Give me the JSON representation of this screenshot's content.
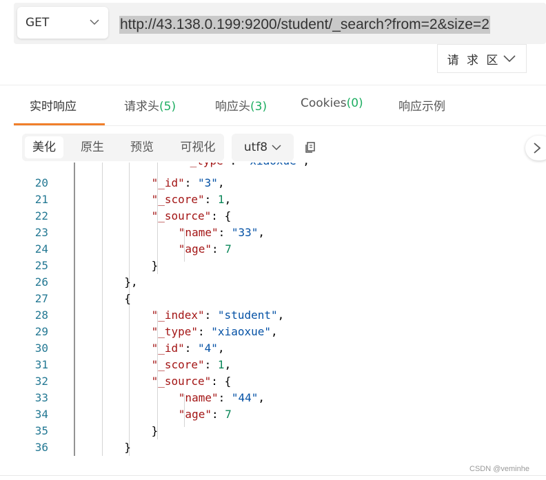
{
  "request": {
    "method": "GET",
    "url": "http://43.138.0.199:9200/student/_search?from=2&size=2",
    "region_label": "请 求 区"
  },
  "tabs": [
    {
      "label": "实时响应",
      "count": ""
    },
    {
      "label": "请求头",
      "count": "(5)"
    },
    {
      "label": "响应头",
      "count": "(3)"
    },
    {
      "label": "Cookies",
      "count": "(0)"
    },
    {
      "label": "响应示例",
      "count": ""
    }
  ],
  "toolbar": {
    "items": [
      "美化",
      "原生",
      "预览",
      "可视化"
    ],
    "encoding": "utf8"
  },
  "code_lines": [
    {
      "n": "20",
      "indent": 6,
      "tokens": [
        {
          "t": "\"_id\"",
          "c": "k"
        },
        {
          "t": ": ",
          "c": ""
        },
        {
          "t": "\"3\"",
          "c": "s"
        },
        {
          "t": ",",
          "c": ""
        }
      ]
    },
    {
      "n": "21",
      "indent": 6,
      "tokens": [
        {
          "t": "\"_score\"",
          "c": "k"
        },
        {
          "t": ": ",
          "c": ""
        },
        {
          "t": "1",
          "c": "n"
        },
        {
          "t": ",",
          "c": ""
        }
      ]
    },
    {
      "n": "22",
      "indent": 6,
      "tokens": [
        {
          "t": "\"_source\"",
          "c": "k"
        },
        {
          "t": ": {",
          "c": ""
        }
      ]
    },
    {
      "n": "23",
      "indent": 8,
      "tokens": [
        {
          "t": "\"name\"",
          "c": "k"
        },
        {
          "t": ": ",
          "c": ""
        },
        {
          "t": "\"33\"",
          "c": "s"
        },
        {
          "t": ",",
          "c": ""
        }
      ]
    },
    {
      "n": "24",
      "indent": 8,
      "tokens": [
        {
          "t": "\"age\"",
          "c": "k"
        },
        {
          "t": ": ",
          "c": ""
        },
        {
          "t": "7",
          "c": "n"
        }
      ]
    },
    {
      "n": "25",
      "indent": 6,
      "tokens": [
        {
          "t": "}",
          "c": ""
        }
      ]
    },
    {
      "n": "26",
      "indent": 4,
      "tokens": [
        {
          "t": "},",
          "c": ""
        }
      ]
    },
    {
      "n": "27",
      "indent": 4,
      "tokens": [
        {
          "t": "{",
          "c": ""
        }
      ]
    },
    {
      "n": "28",
      "indent": 6,
      "tokens": [
        {
          "t": "\"_index\"",
          "c": "k"
        },
        {
          "t": ": ",
          "c": ""
        },
        {
          "t": "\"student\"",
          "c": "s"
        },
        {
          "t": ",",
          "c": ""
        }
      ]
    },
    {
      "n": "29",
      "indent": 6,
      "tokens": [
        {
          "t": "\"_type\"",
          "c": "k"
        },
        {
          "t": ": ",
          "c": ""
        },
        {
          "t": "\"xiaoxue\"",
          "c": "s"
        },
        {
          "t": ",",
          "c": ""
        }
      ]
    },
    {
      "n": "30",
      "indent": 6,
      "tokens": [
        {
          "t": "\"_id\"",
          "c": "k"
        },
        {
          "t": ": ",
          "c": ""
        },
        {
          "t": "\"4\"",
          "c": "s"
        },
        {
          "t": ",",
          "c": ""
        }
      ]
    },
    {
      "n": "31",
      "indent": 6,
      "tokens": [
        {
          "t": "\"_score\"",
          "c": "k"
        },
        {
          "t": ": ",
          "c": ""
        },
        {
          "t": "1",
          "c": "n"
        },
        {
          "t": ",",
          "c": ""
        }
      ]
    },
    {
      "n": "32",
      "indent": 6,
      "tokens": [
        {
          "t": "\"_source\"",
          "c": "k"
        },
        {
          "t": ": {",
          "c": ""
        }
      ]
    },
    {
      "n": "33",
      "indent": 8,
      "tokens": [
        {
          "t": "\"name\"",
          "c": "k"
        },
        {
          "t": ": ",
          "c": ""
        },
        {
          "t": "\"44\"",
          "c": "s"
        },
        {
          "t": ",",
          "c": ""
        }
      ]
    },
    {
      "n": "34",
      "indent": 8,
      "tokens": [
        {
          "t": "\"age\"",
          "c": "k"
        },
        {
          "t": ": ",
          "c": ""
        },
        {
          "t": "7",
          "c": "n"
        }
      ]
    },
    {
      "n": "35",
      "indent": 6,
      "tokens": [
        {
          "t": "}",
          "c": ""
        }
      ]
    },
    {
      "n": "36",
      "indent": 4,
      "tokens": [
        {
          "t": "}",
          "c": ""
        }
      ]
    }
  ],
  "watermark": "CSDN @veminhe",
  "colors": {
    "accent": "#f07f2a",
    "count_green": "#1fae62",
    "key": "#a31515",
    "string": "#0451a5",
    "number": "#098658",
    "line_number": "#237893"
  }
}
